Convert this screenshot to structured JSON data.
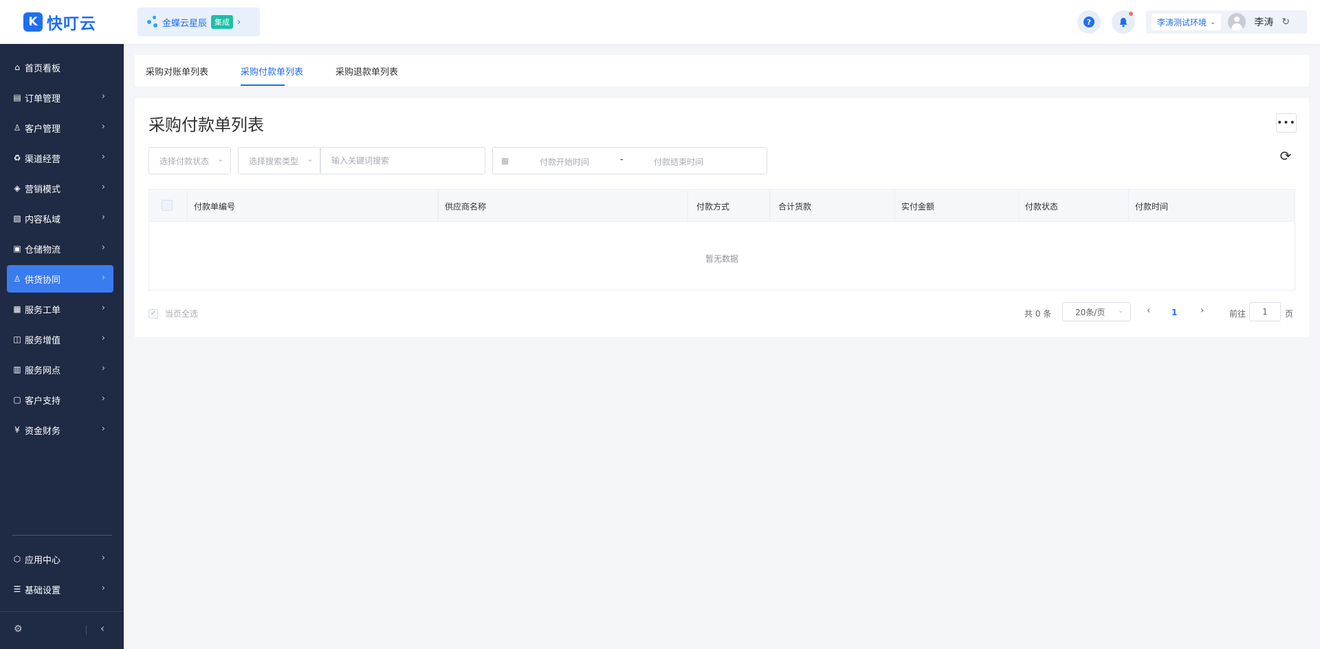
{
  "brand": {
    "logo_glyph": "K",
    "name": "快叮云",
    "color": "#1f6df2"
  },
  "workspace": {
    "name": "金蝶云星辰",
    "badge": "集成",
    "chevron": "›"
  },
  "header": {
    "help_glyph": "?",
    "bell_glyph": "🔔",
    "environment": "李涛测试环境",
    "env_chevron": "⌄",
    "user_name": "李涛",
    "refresh_glyph": "↻"
  },
  "sidebar": {
    "items": [
      {
        "id": "home",
        "label": "首页看板",
        "icon": "⌂",
        "has_children": false
      },
      {
        "id": "orders",
        "label": "订单管理",
        "icon": "▤",
        "has_children": true
      },
      {
        "id": "customers",
        "label": "客户管理",
        "icon": "♙",
        "has_children": true
      },
      {
        "id": "channels",
        "label": "渠道经营",
        "icon": "♻",
        "has_children": true
      },
      {
        "id": "marketing",
        "label": "营销模式",
        "icon": "◈",
        "has_children": true
      },
      {
        "id": "content",
        "label": "内容私域",
        "icon": "▧",
        "has_children": true
      },
      {
        "id": "warehouse",
        "label": "仓储物流",
        "icon": "▣",
        "has_children": true
      },
      {
        "id": "supply",
        "label": "供货协同",
        "icon": "♙",
        "has_children": true,
        "active": true
      },
      {
        "id": "service-orders",
        "label": "服务工单",
        "icon": "▦",
        "has_children": true
      },
      {
        "id": "value-added",
        "label": "服务增值",
        "icon": "◫",
        "has_children": true
      },
      {
        "id": "service-points",
        "label": "服务网点",
        "icon": "▥",
        "has_children": true
      },
      {
        "id": "support",
        "label": "客户支持",
        "icon": "▢",
        "has_children": true
      },
      {
        "id": "finance",
        "label": "资金财务",
        "icon": "¥",
        "has_children": true
      }
    ],
    "bottom_items": [
      {
        "id": "app-center",
        "label": "应用中心",
        "icon": "⬡",
        "has_children": true
      },
      {
        "id": "base-settings",
        "label": "基础设置",
        "icon": "☰",
        "has_children": true
      }
    ],
    "chevron": "›",
    "settings_glyph": "⚙",
    "collapse_glyph": "‹"
  },
  "tabs": [
    {
      "label": "采购对账单列表",
      "active": false
    },
    {
      "label": "采购付款单列表",
      "active": true
    },
    {
      "label": "采购退款单列表",
      "active": false
    }
  ],
  "page": {
    "title": "采购付款单列表",
    "more_glyph": "•••",
    "reload_glyph": "⟳"
  },
  "filters": {
    "status_placeholder": "选择付款状态",
    "type_placeholder": "选择搜索类型",
    "keyword_placeholder": "输入关键词搜索",
    "date_icon": "▦",
    "date_start_placeholder": "付款开始时间",
    "date_separator": "-",
    "date_end_placeholder": "付款结束时间",
    "chevron": "⌄"
  },
  "table": {
    "columns": [
      "付款单编号",
      "供应商名称",
      "付款方式",
      "合计货款",
      "实付金额",
      "付款状态",
      "付款时间"
    ],
    "rows": [],
    "empty_text": "暂无数据"
  },
  "footer": {
    "select_all_label": "当页全选",
    "check_glyph": "✓",
    "total_text": "共 0 条",
    "page_size": "20条/页",
    "size_chevron": "⌄",
    "prev_glyph": "‹",
    "current_page": "1",
    "next_glyph": "›",
    "goto_label": "前往",
    "goto_value": "1",
    "goto_unit": "页"
  }
}
